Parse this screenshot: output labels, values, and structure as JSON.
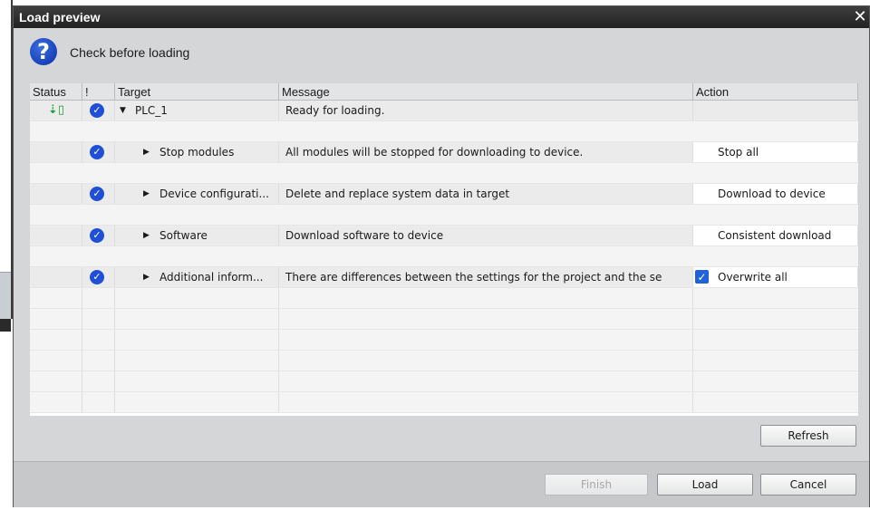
{
  "window": {
    "title": "Load preview",
    "close_glyph": "✕"
  },
  "header": {
    "icon": "question-icon",
    "icon_glyph": "?",
    "text": "Check before loading"
  },
  "table": {
    "columns": [
      "Status",
      "!",
      "Target",
      "Message",
      "Action"
    ],
    "rows": [
      {
        "status_icon": "load-arrow-icon",
        "status_glyph": "⇣▯",
        "check_glyph": "✓",
        "expander": "▼",
        "target": "PLC_1",
        "message": "Ready for loading.",
        "action": ""
      },
      {
        "check_glyph": "✓",
        "expander": "▶",
        "target": "Stop modules",
        "message": "All modules will be stopped for downloading to device.",
        "action": "Stop all"
      },
      {
        "check_glyph": "✓",
        "expander": "▶",
        "target": "Device configurati...",
        "message": "Delete and replace system data in target",
        "action": "Download to device"
      },
      {
        "check_glyph": "✓",
        "expander": "▶",
        "target": "Software",
        "message": "Download software to device",
        "action": "Consistent download"
      },
      {
        "check_glyph": "✓",
        "expander": "▶",
        "target": "Additional inform...",
        "message": "There are differences between the settings for the project and the se",
        "action": "Overwrite all",
        "action_checked_glyph": "✓"
      }
    ]
  },
  "buttons": {
    "refresh": "Refresh",
    "finish": "Finish",
    "load": "Load",
    "cancel": "Cancel"
  },
  "colors": {
    "title_bar": "#222222",
    "accent_blue": "#1f4fd6",
    "status_green": "#1e9a3c"
  }
}
